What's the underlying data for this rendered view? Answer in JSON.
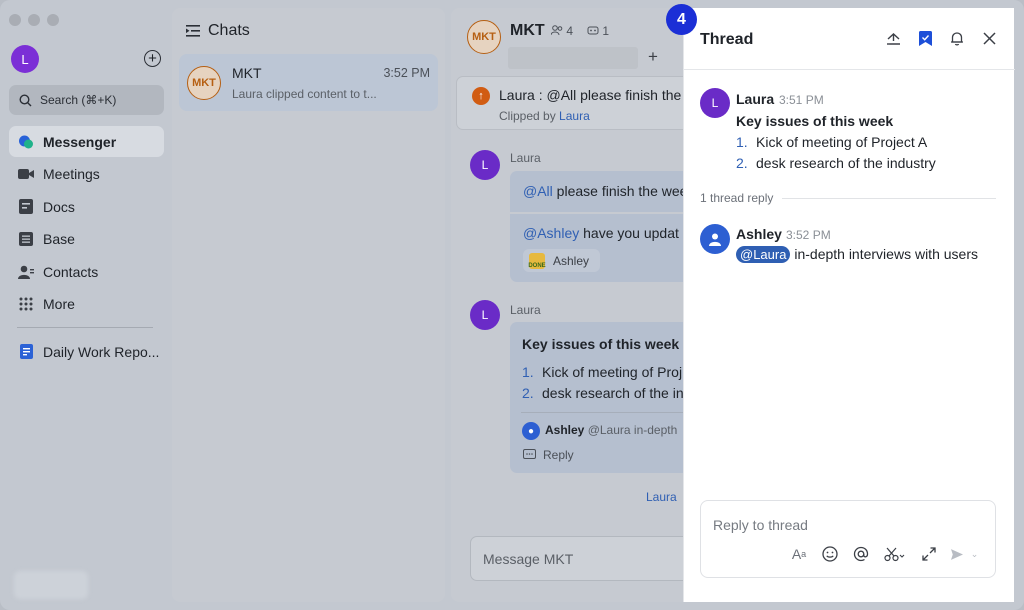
{
  "sidebar": {
    "avatar_initial": "L",
    "search_label": "Search (⌘+K)",
    "items": [
      {
        "label": "Messenger",
        "icon": "messenger-icon"
      },
      {
        "label": "Meetings",
        "icon": "video-icon"
      },
      {
        "label": "Docs",
        "icon": "docs-icon"
      },
      {
        "label": "Base",
        "icon": "base-icon"
      },
      {
        "label": "Contacts",
        "icon": "contacts-icon"
      },
      {
        "label": "More",
        "icon": "grid-icon"
      }
    ],
    "pinned": {
      "label": "Daily Work Repo...",
      "icon": "doc-icon"
    }
  },
  "chatlist": {
    "title": "Chats",
    "row": {
      "avatar": "MKT",
      "name": "MKT",
      "time": "3:52 PM",
      "preview": "Laura clipped content to t..."
    }
  },
  "conversation": {
    "avatar": "MKT",
    "title": "MKT",
    "members": "4",
    "bots": "1",
    "pin": {
      "text": "Laura : @All please finish the w",
      "sub_prefix": "Clipped by",
      "sub_name": "Laura"
    },
    "msg1": {
      "sender": "Laura",
      "avatar": "L",
      "line1_mention": "@All",
      "line1_text": " please finish the wee",
      "line2_mention": "@Ashley",
      "line2_text": " have you updat",
      "chip": "Ashley",
      "done_label": "DONE"
    },
    "msg2": {
      "sender": "Laura",
      "avatar": "L",
      "title": "Key issues of this week",
      "items": [
        {
          "num": "1.",
          "text": "Kick of meeting of Proj"
        },
        {
          "num": "2.",
          "text": "desk research of the in"
        }
      ],
      "thread_name": "Ashley",
      "thread_preview": "@Laura in-depth",
      "reply_label": "Reply"
    },
    "read_by": "Laura",
    "composer_placeholder": "Message MKT"
  },
  "thread": {
    "badge": "4",
    "title": "Thread",
    "root": {
      "avatar": "L",
      "name": "Laura",
      "time": "3:51 PM",
      "title": "Key issues of this week",
      "items": [
        {
          "num": "1.",
          "text": "Kick of meeting of Project A"
        },
        {
          "num": "2.",
          "text": "desk research of the industry"
        }
      ]
    },
    "reply_count": "1 thread reply",
    "reply": {
      "name": "Ashley",
      "time": "3:52 PM",
      "mention": "@Laura",
      "text": " in-depth interviews with users"
    },
    "composer_placeholder": "Reply to thread"
  },
  "colors": {
    "accent": "#2f5fb3",
    "badge": "#1b2fd6",
    "purple": "#6a2bc7"
  }
}
